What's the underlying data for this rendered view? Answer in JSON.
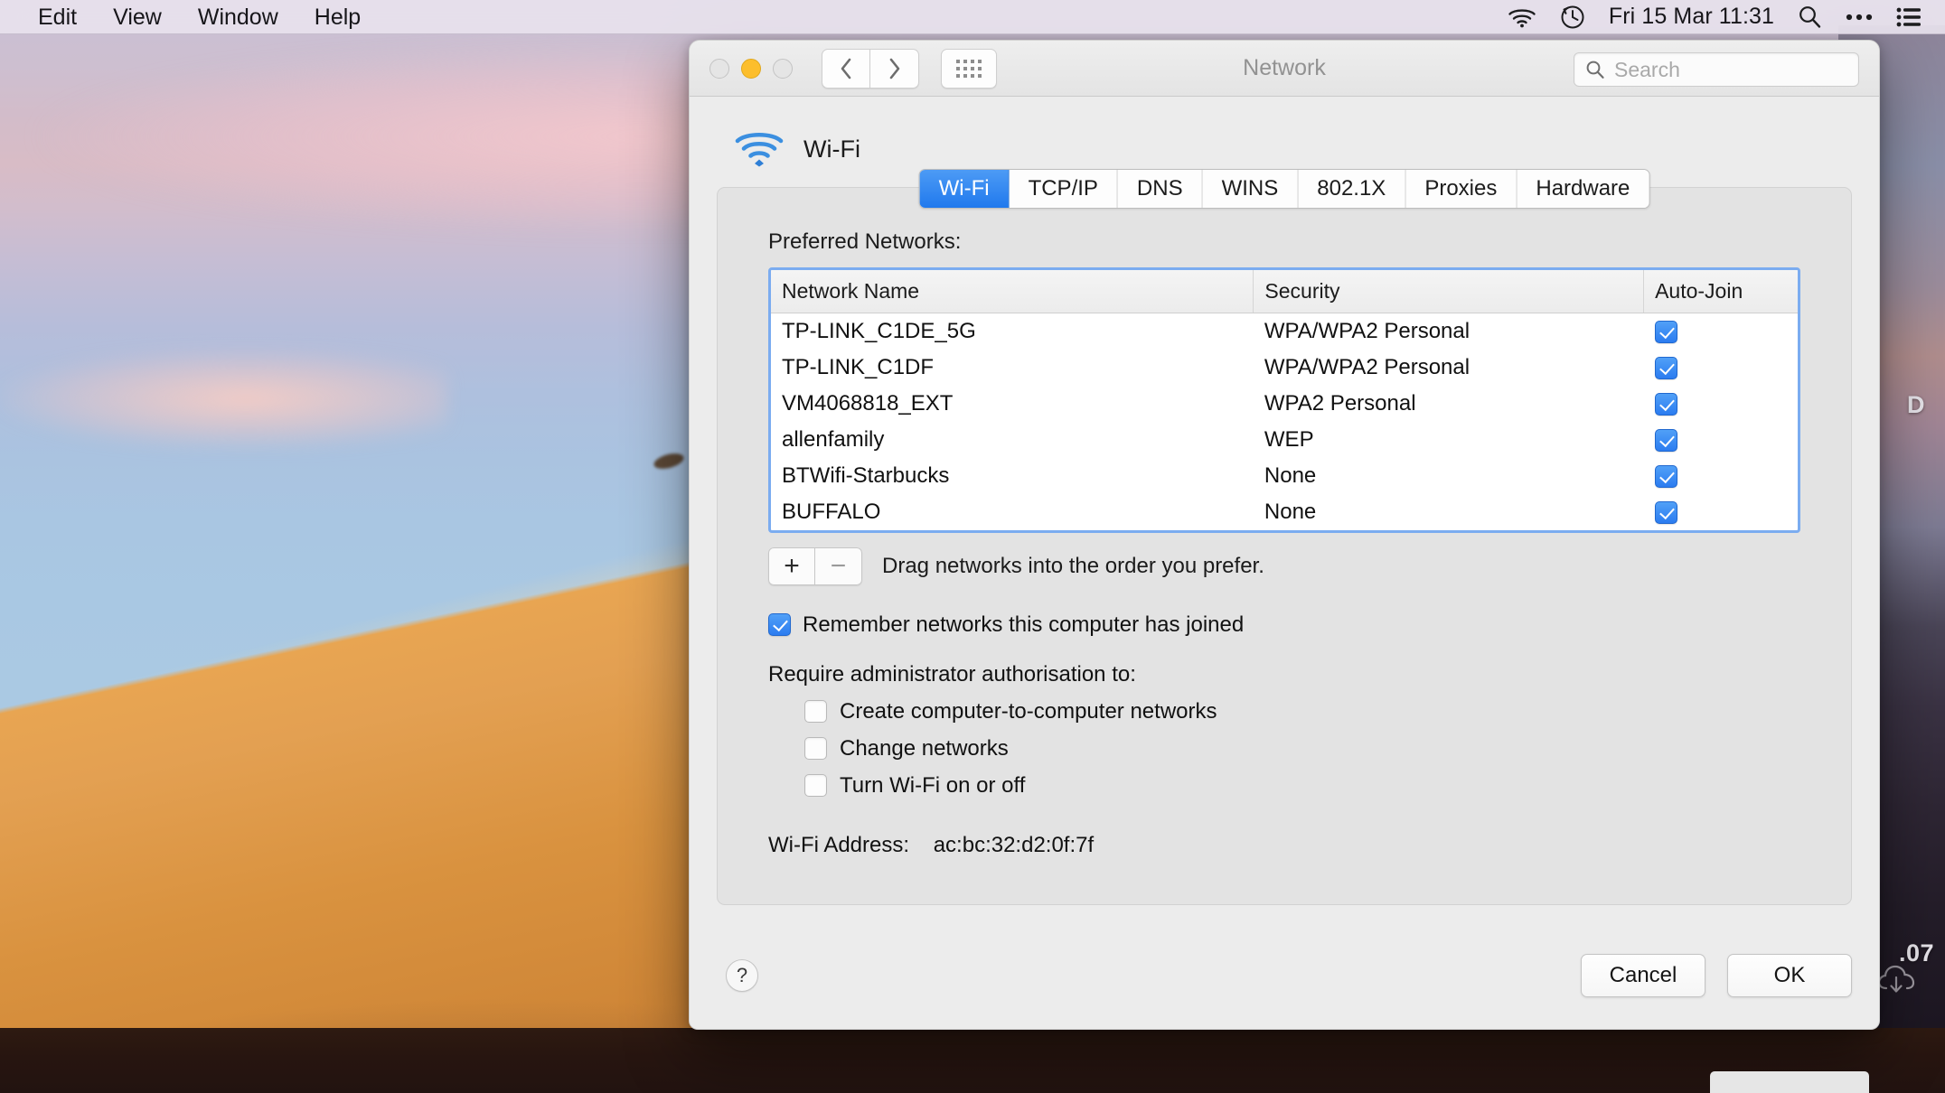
{
  "menubar": {
    "items": [
      {
        "label": "Edit"
      },
      {
        "label": "View"
      },
      {
        "label": "Window"
      },
      {
        "label": "Help"
      }
    ],
    "status": {
      "wifi_icon": "wifi-icon",
      "timemachine_icon": "time-machine-icon",
      "clock": "Fri 15 Mar  11:31",
      "search_icon": "search-icon",
      "control_center_icon": "control-center-icon",
      "notification_center_icon": "notification-center-icon"
    }
  },
  "window": {
    "title": "Network",
    "traffic_lights": {
      "close": "close",
      "minimize": "minimize",
      "zoom": "zoom"
    },
    "nav": {
      "back_icon": "chevron-left-icon",
      "forward_icon": "chevron-right-icon",
      "grid_icon": "show-all-icon"
    },
    "search": {
      "placeholder": "Search",
      "value": ""
    }
  },
  "service": {
    "icon": "wifi-icon",
    "name": "Wi-Fi"
  },
  "tabs": [
    {
      "label": "Wi-Fi",
      "active": true
    },
    {
      "label": "TCP/IP",
      "active": false
    },
    {
      "label": "DNS",
      "active": false
    },
    {
      "label": "WINS",
      "active": false
    },
    {
      "label": "802.1X",
      "active": false
    },
    {
      "label": "Proxies",
      "active": false
    },
    {
      "label": "Hardware",
      "active": false
    }
  ],
  "preferred_networks": {
    "label": "Preferred Networks:",
    "columns": [
      "Network Name",
      "Security",
      "Auto-Join"
    ],
    "rows": [
      {
        "name": "TP-LINK_C1DE_5G",
        "security": "WPA/WPA2 Personal",
        "auto_join": true
      },
      {
        "name": "TP-LINK_C1DF",
        "security": "WPA/WPA2 Personal",
        "auto_join": true
      },
      {
        "name": "VM4068818_EXT",
        "security": "WPA2 Personal",
        "auto_join": true
      },
      {
        "name": "allenfamily",
        "security": "WEP",
        "auto_join": true
      },
      {
        "name": "BTWifi-Starbucks",
        "security": "None",
        "auto_join": true
      },
      {
        "name": "BUFFALO",
        "security": "None",
        "auto_join": true
      }
    ],
    "add_button": "+",
    "remove_button": "−",
    "drag_hint": "Drag networks into the order you prefer."
  },
  "options": {
    "remember_networks": {
      "label": "Remember networks this computer has joined",
      "checked": true
    },
    "admin_label": "Require administrator authorisation to:",
    "admin_items": [
      {
        "label": "Create computer-to-computer networks",
        "checked": false
      },
      {
        "label": "Change networks",
        "checked": false
      },
      {
        "label": "Turn Wi-Fi on or off",
        "checked": false
      }
    ]
  },
  "wifi_address": {
    "label": "Wi-Fi Address:",
    "value": "ac:bc:32:d2:0f:7f"
  },
  "footer": {
    "help_label": "?",
    "cancel_label": "Cancel",
    "ok_label": "OK"
  },
  "desktop": {
    "right_edge_text_top": "D",
    "right_edge_text_bottom": ".07",
    "cloud_download_icon": "cloud-download-icon"
  },
  "colors": {
    "accent_blue": "#2b7cf0",
    "tab_active_blue": "#2079ed",
    "focus_ring": "#7bacf0",
    "minimize_yellow": "#fcbe2c",
    "wifi_icon_blue": "#3b8fe0"
  }
}
